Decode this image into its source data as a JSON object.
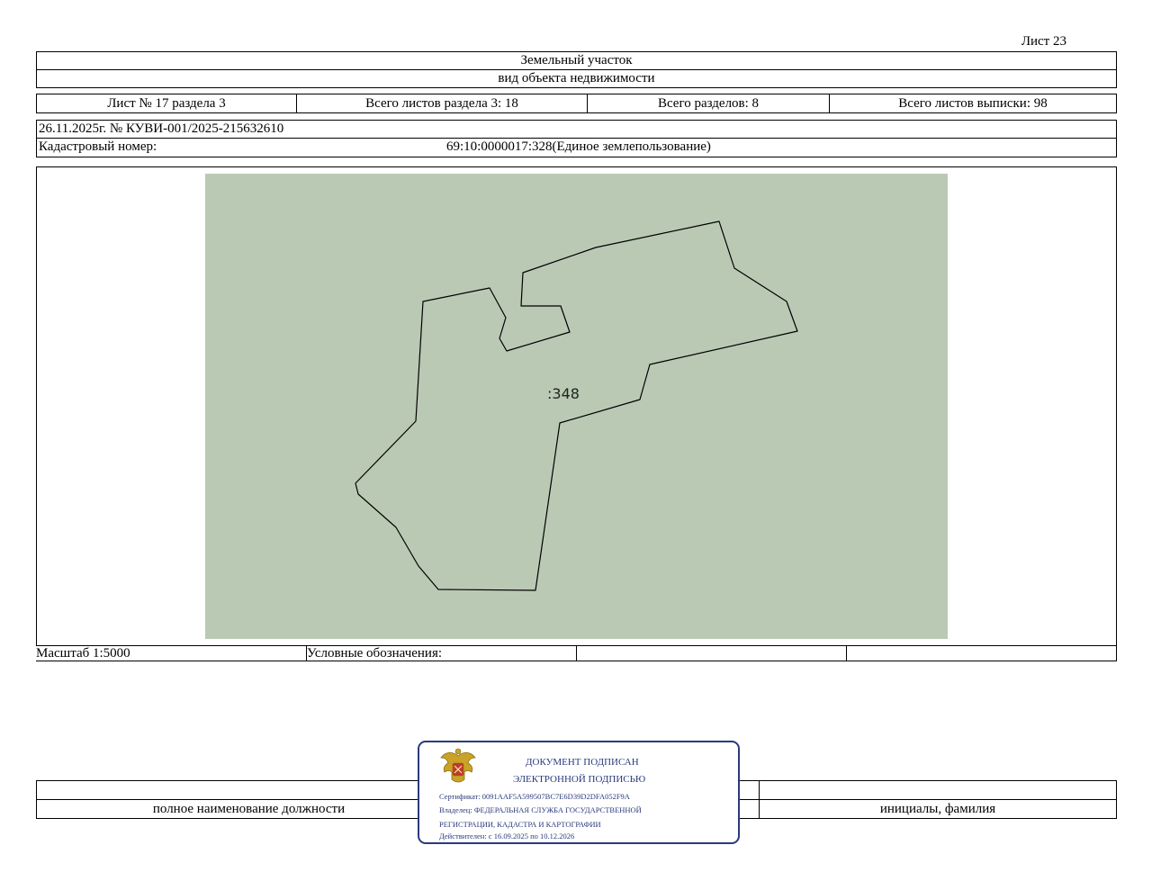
{
  "sheet_label": "Лист 23",
  "header": {
    "title": "Земельный участок",
    "subtitle": "вид объекта недвижимости"
  },
  "section_info": {
    "sheet_no": "Лист № 17 раздела 3",
    "sheets_in_section": "Всего листов раздела 3: 18",
    "total_sections": "Всего разделов: 8",
    "total_sheets": "Всего листов выписки: 98"
  },
  "extract": {
    "date_number": "26.11.2025г. № КУВИ-001/2025-215632610",
    "cadastral_label": "Кадастровый номер:",
    "cadastral_number": "69:10:0000017:328(Единое землепользование)"
  },
  "map": {
    "parcel_label": ":348",
    "fill_color": "#bac9b4",
    "boundary_color": "#000000"
  },
  "footer_row": {
    "scale": "Масштаб 1:5000",
    "legend_label": "Условные обозначения:"
  },
  "signature": {
    "position_caption": "полное наименование должности",
    "name_caption": "инициалы, фамилия"
  },
  "stamp": {
    "line1": "ДОКУМЕНТ ПОДПИСАН",
    "line2": "ЭЛЕКТРОННОЙ ПОДПИСЬЮ",
    "certificate": "Сертификат: 0091AAF5A599507BC7E6D39D2DFA052F9A",
    "owner_line1": "Владелец: ФЕДЕРАЛЬНАЯ СЛУЖБА ГОСУДАРСТВЕННОЙ",
    "owner_line2": "РЕГИСТРАЦИИ, КАДАСТРА И КАРТОГРАФИИ",
    "validity": "Действителен: с 16.09.2025 по 10.12.2026",
    "emblem_icon": "double-headed-eagle-emblem-icon",
    "color": "#2a3a7c"
  }
}
